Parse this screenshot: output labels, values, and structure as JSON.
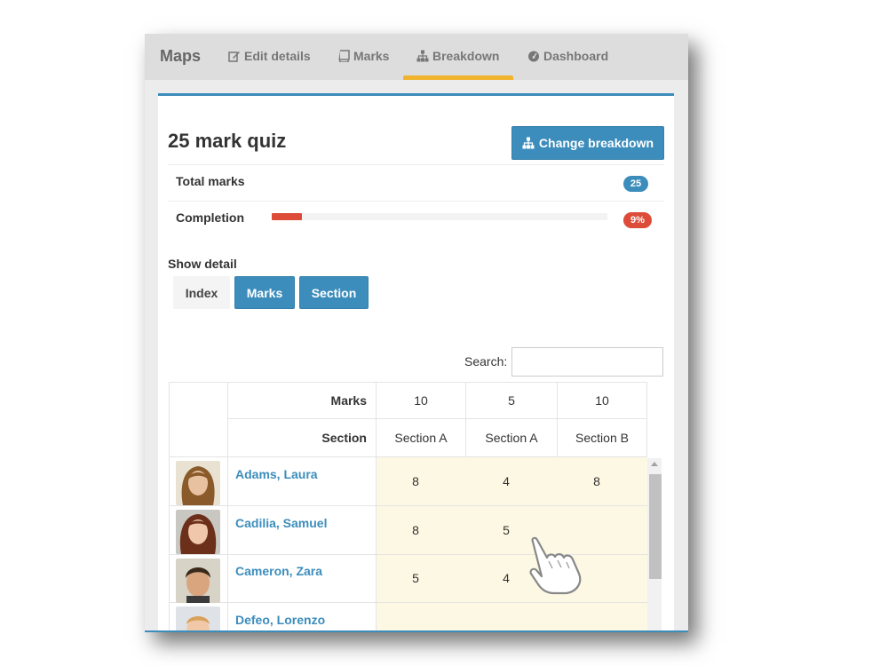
{
  "navbar": {
    "brand": "Maps",
    "tabs": [
      {
        "label": "Edit details",
        "icon": "edit-icon"
      },
      {
        "label": "Marks",
        "icon": "book-icon"
      },
      {
        "label": "Breakdown",
        "icon": "sitemap-icon",
        "active": true
      },
      {
        "label": "Dashboard",
        "icon": "dashboard-icon"
      }
    ]
  },
  "quiz": {
    "title": "25 mark quiz",
    "change_button": "Change breakdown",
    "total_marks_label": "Total marks",
    "total_marks": "25",
    "completion_label": "Completion",
    "completion": "9%",
    "completion_fraction": 0.09
  },
  "show_detail": {
    "label": "Show detail",
    "options": [
      {
        "label": "Index",
        "selected": false
      },
      {
        "label": "Marks",
        "selected": true
      },
      {
        "label": "Section",
        "selected": true
      }
    ]
  },
  "search": {
    "label": "Search:",
    "value": ""
  },
  "table": {
    "header_marks_label": "Marks",
    "header_section_label": "Section",
    "columns": [
      {
        "marks": "10",
        "section": "Section A"
      },
      {
        "marks": "5",
        "section": "Section A"
      },
      {
        "marks": "10",
        "section": "Section B"
      }
    ],
    "rows": [
      {
        "name": "Adams, Laura",
        "values": [
          "8",
          "4",
          "8"
        ]
      },
      {
        "name": "Cadilia, Samuel",
        "values": [
          "8",
          "5",
          ""
        ]
      },
      {
        "name": "Cameron, Zara",
        "values": [
          "5",
          "4",
          ""
        ]
      },
      {
        "name": "Defeo, Lorenzo",
        "values": [
          "",
          "",
          ""
        ]
      }
    ]
  },
  "colors": {
    "primary": "#3c8dbc",
    "danger": "#dd4b39",
    "active_tab": "#f0b32e",
    "cell_highlight": "#fcf8e3"
  }
}
